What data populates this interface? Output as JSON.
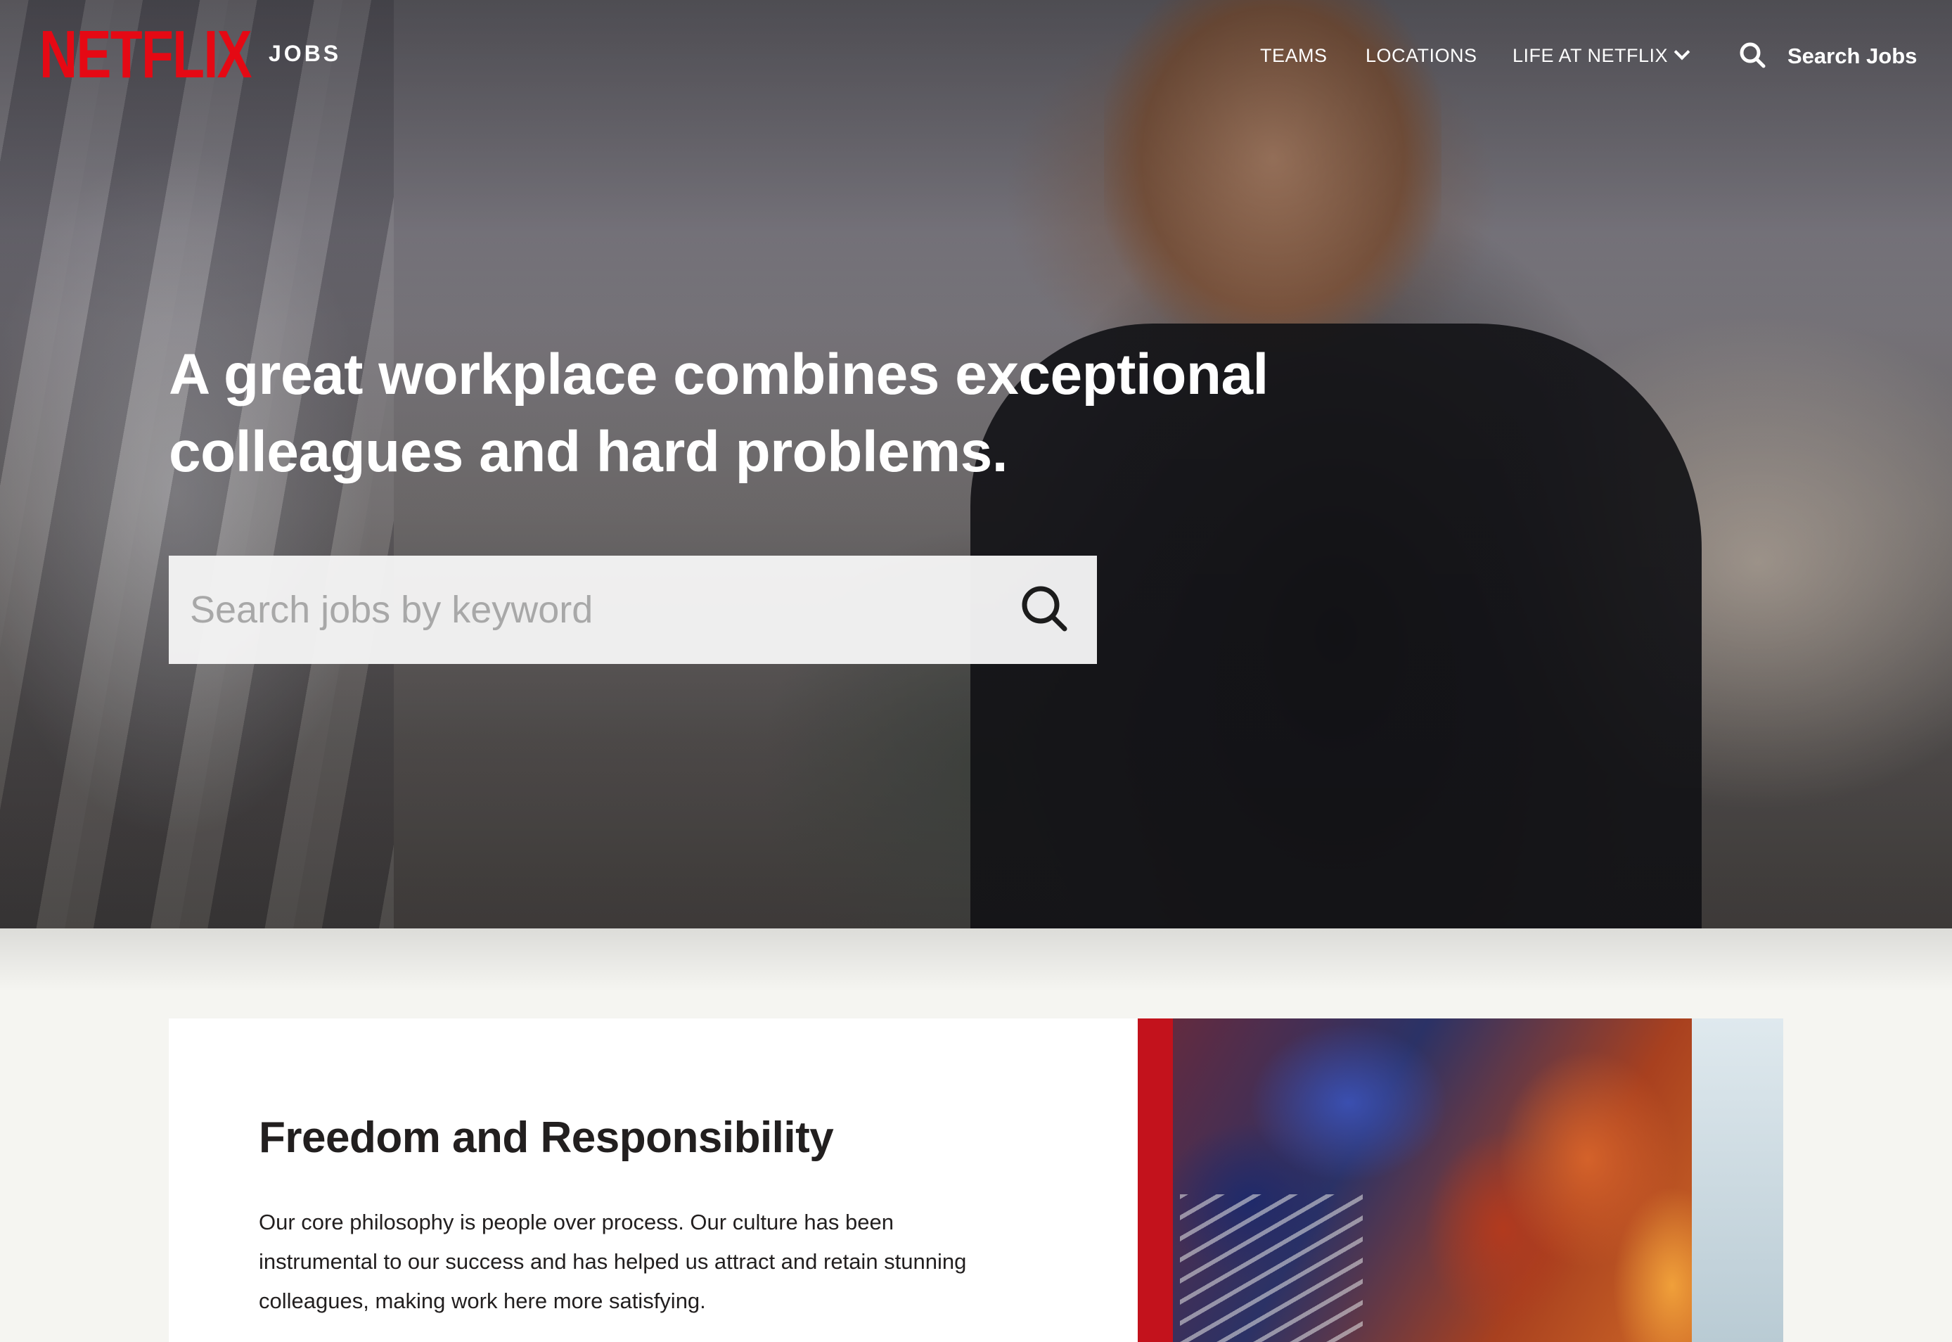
{
  "brand": {
    "logo": "NETFLIX",
    "section": "JOBS"
  },
  "nav": {
    "items": [
      {
        "label": "TEAMS"
      },
      {
        "label": "LOCATIONS"
      },
      {
        "label": "LIFE AT NETFLIX"
      }
    ],
    "search_label": "Search Jobs"
  },
  "hero": {
    "headline_line1": "A great workplace combines exceptional",
    "headline_line2": "colleagues and hard problems.",
    "search_placeholder": "Search jobs by keyword"
  },
  "section": {
    "title": "Freedom and Responsibility",
    "body_line1": "Our core philosophy is people over process. Our culture has been",
    "body_line2": "instrumental to our success and has helped us attract and retain stunning",
    "body_line3": "colleagues, making work here more satisfying."
  },
  "colors": {
    "brand_red": "#e50914",
    "page_background": "#f5f5f1",
    "text_dark": "#221f1f"
  },
  "icons": {
    "nav_search": "search-icon",
    "hero_search": "search-icon",
    "dropdown": "chevron-down-icon"
  }
}
